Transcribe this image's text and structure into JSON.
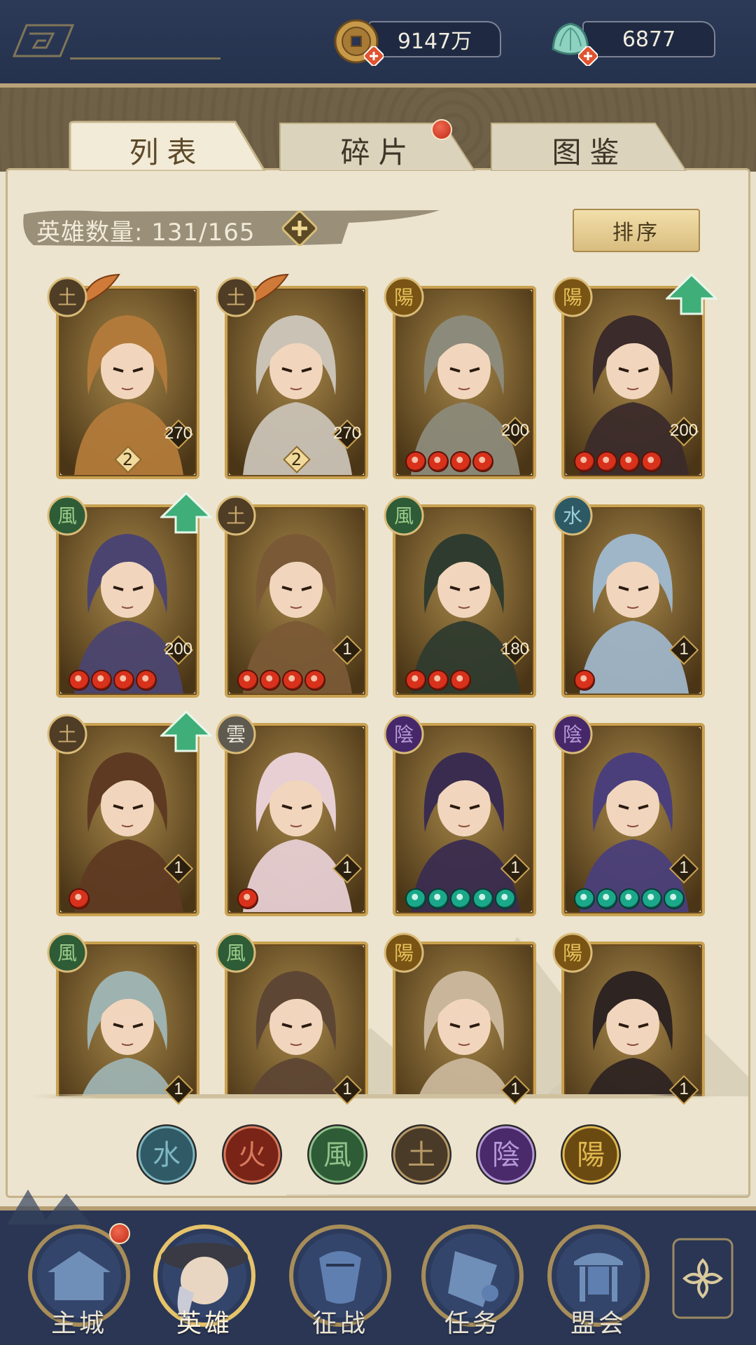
{
  "resources": {
    "coins": "9147万",
    "jade": "6877"
  },
  "tabs": [
    {
      "label": "列表",
      "active": true
    },
    {
      "label": "碎片",
      "active": false,
      "badge": true
    },
    {
      "label": "图鉴",
      "active": false
    }
  ],
  "hero_count": {
    "label": "英雄数量:",
    "value": "131/165"
  },
  "sort_button": "排序",
  "heroes": [
    {
      "element": "土",
      "level": "270",
      "rank": "2",
      "stars": 0,
      "star_color": "red",
      "upgrade": false,
      "palette": "#b27a3a"
    },
    {
      "element": "土",
      "level": "270",
      "rank": "2",
      "stars": 0,
      "star_color": "red",
      "upgrade": false,
      "palette": "#c9c2b5"
    },
    {
      "element": "陽",
      "level": "200",
      "rank": "",
      "stars": 4,
      "star_color": "red",
      "upgrade": false,
      "palette": "#8c8a7a"
    },
    {
      "element": "陽",
      "level": "200",
      "rank": "",
      "stars": 4,
      "star_color": "red",
      "upgrade": true,
      "palette": "#3b2b2a"
    },
    {
      "element": "風",
      "level": "200",
      "rank": "",
      "stars": 4,
      "star_color": "red",
      "upgrade": true,
      "palette": "#4b4470"
    },
    {
      "element": "土",
      "level": "1",
      "rank": "",
      "stars": 4,
      "star_color": "red",
      "upgrade": false,
      "palette": "#7a5a36"
    },
    {
      "element": "風",
      "level": "180",
      "rank": "",
      "stars": 3,
      "star_color": "red",
      "upgrade": false,
      "palette": "#2f3b2e"
    },
    {
      "element": "水",
      "level": "1",
      "rank": "",
      "stars": 1,
      "star_color": "red",
      "upgrade": false,
      "palette": "#9fb5c8"
    },
    {
      "element": "土",
      "level": "1",
      "rank": "",
      "stars": 1,
      "star_color": "red",
      "upgrade": true,
      "palette": "#5e3a22"
    },
    {
      "element": "雲",
      "level": "1",
      "rank": "",
      "stars": 1,
      "star_color": "red",
      "upgrade": false,
      "palette": "#e7cfd3"
    },
    {
      "element": "陰",
      "level": "1",
      "rank": "",
      "stars": 5,
      "star_color": "teal",
      "upgrade": false,
      "palette": "#3a2c4f"
    },
    {
      "element": "陰",
      "level": "1",
      "rank": "",
      "stars": 5,
      "star_color": "teal",
      "upgrade": false,
      "palette": "#4a3f7a"
    },
    {
      "element": "風",
      "level": "1",
      "rank": "",
      "stars": 0,
      "star_color": "red",
      "upgrade": false,
      "palette": "#9eb2b0"
    },
    {
      "element": "風",
      "level": "1",
      "rank": "",
      "stars": 0,
      "star_color": "red",
      "upgrade": false,
      "palette": "#5d4634"
    },
    {
      "element": "陽",
      "level": "1",
      "rank": "",
      "stars": 0,
      "star_color": "red",
      "upgrade": false,
      "palette": "#c9b69a"
    },
    {
      "element": "陽",
      "level": "1",
      "rank": "",
      "stars": 0,
      "star_color": "red",
      "upgrade": false,
      "palette": "#2e2422"
    }
  ],
  "element_filters": [
    {
      "glyph": "水",
      "color": "#2f5a66",
      "ring": "#7fb7c0"
    },
    {
      "glyph": "火",
      "color": "#7a2417",
      "ring": "#d8795c"
    },
    {
      "glyph": "風",
      "color": "#2e5c36",
      "ring": "#8fc28a"
    },
    {
      "glyph": "土",
      "color": "#4a3b28",
      "ring": "#b89a68"
    },
    {
      "glyph": "陰",
      "color": "#4a2a6a",
      "ring": "#b699d8"
    },
    {
      "glyph": "陽",
      "color": "#6b4a12",
      "ring": "#e0b84e"
    }
  ],
  "nav": [
    {
      "label": "主城",
      "badge": true
    },
    {
      "label": "英雄",
      "active": true
    },
    {
      "label": "征战"
    },
    {
      "label": "任务"
    },
    {
      "label": "盟会"
    }
  ]
}
